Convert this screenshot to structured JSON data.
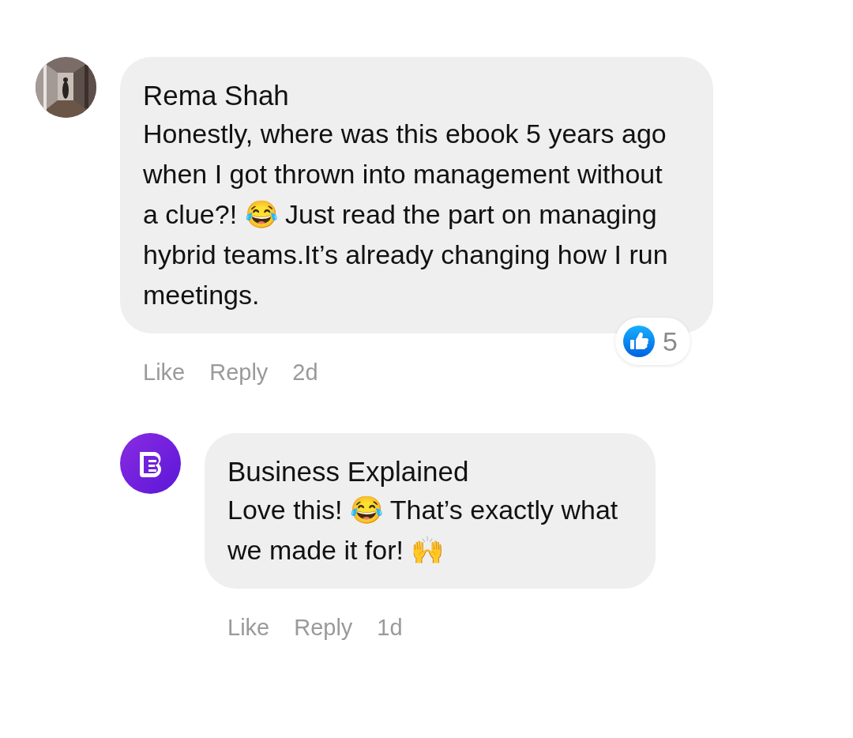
{
  "comments": [
    {
      "author": "Rema Shah",
      "text": "Honestly, where was this ebook 5 years ago when I got thrown into management without a clue?! 😂 Just read the part on managing hybrid teams.It’s already changing how I run meetings.",
      "reactions": {
        "count": "5"
      },
      "actions": [
        "Like",
        "Reply",
        "2d"
      ],
      "replies": [
        {
          "author": "Business Explained",
          "avatar": {
            "kind": "logo"
          },
          "text": "Love this! 😂 That’s exactly what we made it for! 🙌",
          "actions": [
            "Like",
            "Reply",
            "1d"
          ]
        }
      ]
    }
  ]
}
